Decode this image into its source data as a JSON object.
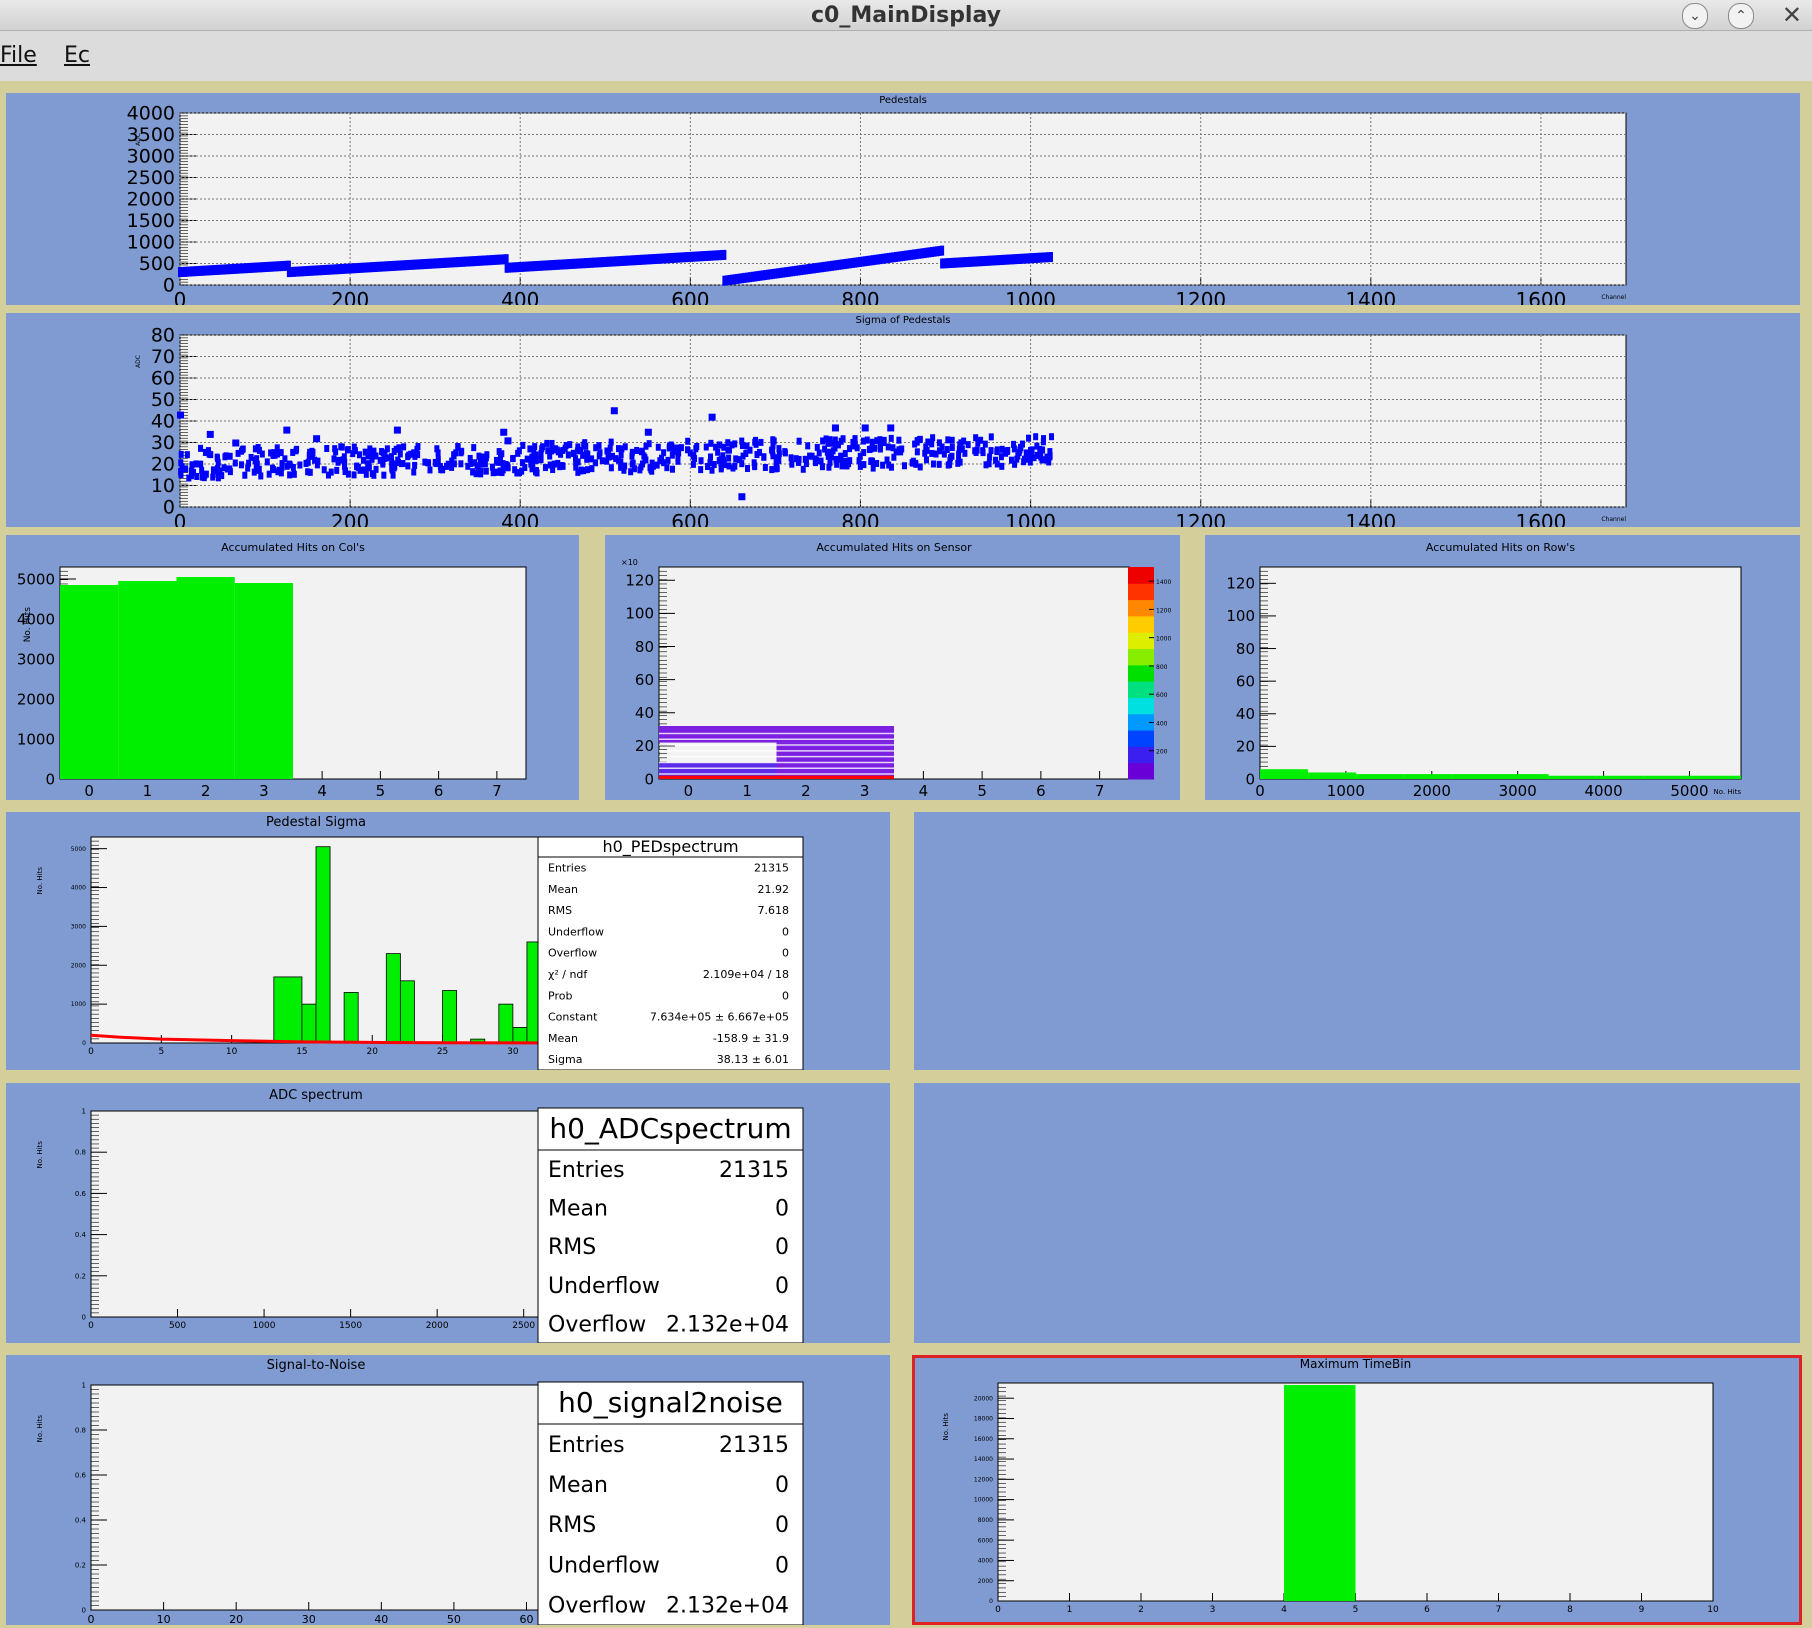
{
  "window": {
    "title": "c0_MainDisplay",
    "minimize_icon": "chevron-down-icon",
    "maximize_icon": "chevron-up-icon",
    "close_icon": "close-icon"
  },
  "menu": {
    "file": "File",
    "edit": "Ec"
  },
  "pads": {
    "pedestals": {
      "title": "Pedestals",
      "ylabel": "ADC",
      "xlabel": "Channel",
      "xticks": [
        "0",
        "200",
        "400",
        "600",
        "800",
        "1000",
        "1200",
        "1400",
        "1600"
      ],
      "yticks": [
        "0",
        "500",
        "1000",
        "1500",
        "2000",
        "2500",
        "3000",
        "3500",
        "4000"
      ]
    },
    "sigma": {
      "title": "Sigma of Pedestals",
      "ylabel": "ADC",
      "xlabel": "Channel",
      "xticks": [
        "0",
        "200",
        "400",
        "600",
        "800",
        "1000",
        "1200",
        "1400",
        "1600"
      ],
      "yticks": [
        "0",
        "10",
        "20",
        "30",
        "40",
        "50",
        "60",
        "70",
        "80"
      ]
    },
    "cols": {
      "title": "Accumulated Hits on Col's",
      "ylabel": "No. Hits",
      "xticks": [
        "0",
        "1",
        "2",
        "3",
        "4",
        "5",
        "6",
        "7"
      ],
      "yticks": [
        "0",
        "1000",
        "2000",
        "3000",
        "4000",
        "5000"
      ]
    },
    "sensor": {
      "title": "Accumulated Hits on Sensor",
      "xticks": [
        "0",
        "1",
        "2",
        "3",
        "4",
        "5",
        "6",
        "7"
      ],
      "yticks": [
        "0",
        "20",
        "40",
        "60",
        "80",
        "100",
        "120"
      ],
      "zticks": [
        "200",
        "400",
        "600",
        "800",
        "1000",
        "1200",
        "1400"
      ],
      "yexp": "×10"
    },
    "rows": {
      "title": "Accumulated Hits on Row's",
      "xlabel": "No. Hits",
      "xticks": [
        "0",
        "1000",
        "2000",
        "3000",
        "4000",
        "5000"
      ],
      "yticks": [
        "0",
        "20",
        "40",
        "60",
        "80",
        "100",
        "120"
      ]
    },
    "pedsigma": {
      "title": "Pedestal Sigma",
      "ylabel": "No. Hits",
      "xticks": [
        "0",
        "5",
        "10",
        "15",
        "20",
        "25",
        "30"
      ],
      "yticks": [
        "0",
        "1000",
        "2000",
        "3000",
        "4000",
        "5000"
      ],
      "stats": {
        "name": "h0_PEDspectrum",
        "rows": [
          [
            "Entries",
            "21315"
          ],
          [
            "Mean",
            "21.92"
          ],
          [
            "RMS",
            "7.618"
          ],
          [
            "Underflow",
            "0"
          ],
          [
            "Overflow",
            "0"
          ],
          [
            "χ² / ndf",
            "2.109e+04 / 18"
          ],
          [
            "Prob",
            "0"
          ],
          [
            "Constant",
            "7.634e+05 ± 6.667e+05"
          ],
          [
            "Mean",
            "-158.9 ± 31.9"
          ],
          [
            "Sigma",
            "38.13 ± 6.01"
          ]
        ]
      }
    },
    "adc": {
      "title": "ADC spectrum",
      "ylabel": "No. Hits",
      "xticks": [
        "0",
        "500",
        "1000",
        "1500",
        "2000",
        "2500"
      ],
      "yticks": [
        "0",
        "0.2",
        "0.4",
        "0.6",
        "0.8",
        "1"
      ],
      "stats": {
        "name": "h0_ADCspectrum",
        "rows": [
          [
            "Entries",
            "21315"
          ],
          [
            "Mean",
            "0"
          ],
          [
            "RMS",
            "0"
          ],
          [
            "Underflow",
            "0"
          ],
          [
            "Overflow",
            "2.132e+04"
          ]
        ]
      }
    },
    "s2n": {
      "title": "Signal-to-Noise",
      "ylabel": "No. Hits",
      "xticks": [
        "0",
        "10",
        "20",
        "30",
        "40",
        "50",
        "60"
      ],
      "yticks": [
        "0",
        "0.2",
        "0.4",
        "0.6",
        "0.8",
        "1"
      ],
      "stats": {
        "name": "h0_signal2noise",
        "rows": [
          [
            "Entries",
            "21315"
          ],
          [
            "Mean",
            "0"
          ],
          [
            "RMS",
            "0"
          ],
          [
            "Underflow",
            "0"
          ],
          [
            "Overflow",
            "2.132e+04"
          ]
        ]
      }
    },
    "timebin": {
      "title": "Maximum TimeBin",
      "ylabel": "No. Hits",
      "xticks": [
        "0",
        "1",
        "2",
        "3",
        "4",
        "5",
        "6",
        "7",
        "8",
        "9",
        "10"
      ],
      "yticks": [
        "0",
        "2000",
        "4000",
        "6000",
        "8000",
        "10000",
        "12000",
        "14000",
        "16000",
        "18000",
        "20000"
      ]
    }
  },
  "chart_data": [
    {
      "type": "scatter",
      "title": "Pedestals",
      "xlabel": "Channel",
      "ylabel": "ADC",
      "xlim": [
        0,
        1700
      ],
      "ylim": [
        0,
        4000
      ],
      "color": "#0000ff",
      "segments": [
        {
          "x": [
            0,
            128
          ],
          "y": [
            300,
            450
          ]
        },
        {
          "x": [
            128,
            384
          ],
          "y": [
            300,
            600
          ]
        },
        {
          "x": [
            384,
            640
          ],
          "y": [
            400,
            700
          ]
        },
        {
          "x": [
            640,
            896
          ],
          "y": [
            100,
            800
          ]
        },
        {
          "x": [
            896,
            1024
          ],
          "y": [
            500,
            650
          ]
        }
      ]
    },
    {
      "type": "scatter",
      "title": "Sigma of Pedestals",
      "xlabel": "Channel",
      "ylabel": "ADC",
      "xlim": [
        0,
        1700
      ],
      "ylim": [
        0,
        80
      ],
      "color": "#0000ff",
      "band": {
        "x": [
          0,
          1024
        ],
        "y_center": [
          20,
          26
        ],
        "spread": 7
      },
      "outliers": {
        "x": [
          0,
          35,
          65,
          125,
          160,
          255,
          385,
          380,
          510,
          550,
          625,
          660,
          770,
          805,
          835
        ],
        "y": [
          43,
          34,
          30,
          36,
          32,
          36,
          31,
          35,
          45,
          35,
          42,
          5,
          37,
          37,
          37
        ]
      }
    },
    {
      "type": "bar",
      "title": "Accumulated Hits on Col's",
      "ylabel": "No. Hits",
      "xlim": [
        -0.5,
        7.5
      ],
      "ylim": [
        0,
        5300
      ],
      "color": "#00ee00",
      "categories": [
        "0",
        "1",
        "2",
        "3"
      ],
      "values": [
        4850,
        4950,
        5050,
        4900
      ]
    },
    {
      "type": "heatmap",
      "title": "Accumulated Hits on Sensor",
      "xlim": [
        -0.5,
        7.5
      ],
      "ylim": [
        0,
        128
      ],
      "zlim": [
        0,
        1500
      ],
      "blocks": [
        {
          "x": [
            -0.5,
            1.5
          ],
          "y": [
            0,
            10
          ],
          "z": 100
        },
        {
          "x": [
            1.5,
            3.5
          ],
          "y": [
            0,
            22
          ],
          "z": 80
        },
        {
          "x": [
            -0.5,
            3.5
          ],
          "y": [
            22,
            32
          ],
          "z": 60
        },
        {
          "x": [
            -0.5,
            3.5
          ],
          "y": [
            0,
            2
          ],
          "z": 1400
        }
      ]
    },
    {
      "type": "bar",
      "title": "Accumulated Hits on Row's",
      "xlabel": "No. Hits",
      "xlim": [
        0,
        5600
      ],
      "ylim": [
        0,
        130
      ],
      "color": "#00ee00",
      "values": [
        6,
        4,
        3,
        3,
        3,
        3,
        2,
        2,
        2,
        2
      ]
    },
    {
      "type": "bar",
      "title": "Pedestal Sigma",
      "ylabel": "No. Hits",
      "xlim": [
        0,
        32
      ],
      "ylim": [
        0,
        5300
      ],
      "color": "#00ee00",
      "bins": [
        [
          13,
          15,
          1700
        ],
        [
          15,
          16,
          1000
        ],
        [
          16,
          17,
          5050
        ],
        [
          18,
          19,
          1300
        ],
        [
          21,
          22,
          2300
        ],
        [
          22,
          23,
          1600
        ],
        [
          25,
          26,
          1350
        ],
        [
          27,
          28,
          100
        ],
        [
          29,
          30,
          1000
        ],
        [
          30,
          31,
          400
        ],
        [
          31,
          32,
          2600
        ]
      ],
      "fit": {
        "color": "#ff0000",
        "x": [
          0,
          2,
          5,
          10,
          15,
          20,
          25,
          32
        ],
        "y": [
          200,
          150,
          100,
          60,
          30,
          15,
          8,
          3
        ]
      }
    },
    {
      "type": "bar",
      "title": "ADC spectrum",
      "ylabel": "No. Hits",
      "xlim": [
        0,
        2600
      ],
      "ylim": [
        0,
        1
      ],
      "values": []
    },
    {
      "type": "bar",
      "title": "Signal-to-Noise",
      "ylabel": "No. Hits",
      "xlim": [
        0,
        62
      ],
      "ylim": [
        0,
        1
      ],
      "values": []
    },
    {
      "type": "bar",
      "title": "Maximum TimeBin",
      "ylabel": "No. Hits",
      "xlim": [
        0,
        10
      ],
      "ylim": [
        0,
        21500
      ],
      "color": "#00ee00",
      "bins": [
        [
          4,
          5,
          21300
        ]
      ]
    }
  ]
}
